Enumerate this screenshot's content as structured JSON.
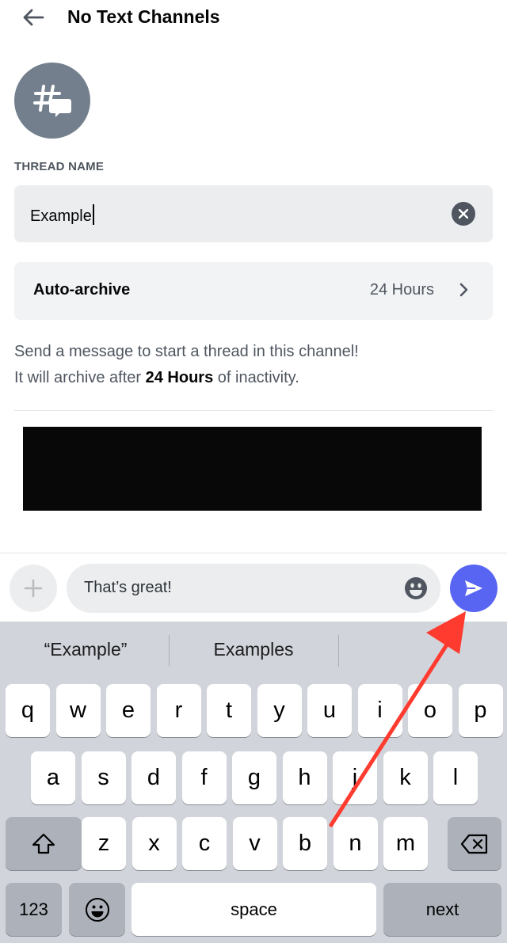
{
  "header": {
    "title": "No Text Channels"
  },
  "form": {
    "thread_name_label": "THREAD NAME",
    "thread_name_value": "Example",
    "auto_archive_label": "Auto-archive",
    "auto_archive_value": "24 Hours"
  },
  "help": {
    "line1": "Send a message to start a thread in this channel!",
    "line2_pre": "It will archive after ",
    "line2_bold": "24 Hours",
    "line2_post": " of inactivity."
  },
  "composer": {
    "message_value": "That’s great!"
  },
  "keyboard": {
    "suggestions": [
      "“Example”",
      "Examples"
    ],
    "row1": [
      "q",
      "w",
      "e",
      "r",
      "t",
      "y",
      "u",
      "i",
      "o",
      "p"
    ],
    "row2": [
      "a",
      "s",
      "d",
      "f",
      "g",
      "h",
      "j",
      "k",
      "l"
    ],
    "row3": [
      "z",
      "x",
      "c",
      "v",
      "b",
      "n",
      "m"
    ],
    "numbers_label": "123",
    "space_label": "space",
    "next_label": "next"
  },
  "colors": {
    "accent": "#5865f2",
    "annotation_arrow": "#ff3b2f"
  }
}
